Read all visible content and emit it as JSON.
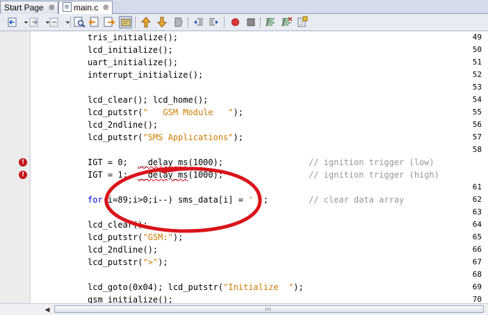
{
  "tabs": [
    {
      "label": "Start Page",
      "active": false
    },
    {
      "label": "main.c",
      "active": true
    }
  ],
  "tab_close_glyph": "⊗",
  "toolbar": {
    "buttons": [
      "back-icon",
      "back-dropdown-icon",
      "forward-icon",
      "forward-dropdown-icon",
      "find-icon",
      "find-previous-icon",
      "find-next-icon",
      "toggle-highlight-icon",
      "previous-bookmark-icon",
      "next-bookmark-icon",
      "toggle-bookmark-icon",
      "shift-left-icon",
      "shift-right-icon",
      "record-macro-icon",
      "stop-macro-icon",
      "comment-icon",
      "uncomment-icon"
    ]
  },
  "lines": [
    {
      "num": "49",
      "code": "tris_initialize();"
    },
    {
      "num": "50",
      "code": "lcd_initialize();"
    },
    {
      "num": "51",
      "code": "uart_initialize();"
    },
    {
      "num": "52",
      "code": "interrupt_initialize();"
    },
    {
      "num": "53",
      "code": ""
    },
    {
      "num": "54",
      "code": "lcd_clear(); lcd_home();"
    },
    {
      "num": "55",
      "pre": "lcd_putstr(",
      "str": "\"   GSM Module   \"",
      "post": ");"
    },
    {
      "num": "56",
      "code": "lcd_2ndline();"
    },
    {
      "num": "57",
      "pre": "lcd_putstr(",
      "str": "\"SMS Applications\"",
      "post": ");"
    },
    {
      "num": "58",
      "code": ""
    },
    {
      "num": "",
      "error": true,
      "pre": "IGT = 0;  ",
      "squig": "__delay_ms",
      "post": "(1000);",
      "comment": "// ignition trigger (low)"
    },
    {
      "num": "",
      "error": true,
      "pre": "IGT = 1;  ",
      "squig": "__delay_ms",
      "post": "(1000);",
      "comment": "// ignition trigger (high)"
    },
    {
      "num": "61",
      "code": ""
    },
    {
      "num": "62",
      "kw": "for",
      "post": "(i=89;i>0;i--) sms_data[i] = ",
      "str": "' '",
      "post2": ";",
      "comment": "// clear data array"
    },
    {
      "num": "63",
      "code": ""
    },
    {
      "num": "64",
      "code": "lcd_clear();"
    },
    {
      "num": "65",
      "pre": "lcd_putstr(",
      "str": "\"GSM:\"",
      "post": ");"
    },
    {
      "num": "66",
      "code": "lcd_2ndline();"
    },
    {
      "num": "67",
      "pre": "lcd_putstr(",
      "str": "\">\"",
      "post": ");"
    },
    {
      "num": "68",
      "code": ""
    },
    {
      "num": "69",
      "pre": "lcd_goto(0x04); lcd_putstr(",
      "str": "\"Initialize  \"",
      "post": ");"
    },
    {
      "num": "70",
      "code": "gsm_initialize();"
    }
  ],
  "error_glyph": "!",
  "scrollbar": {
    "left_arrow": "◀",
    "right_arrow": "▶"
  },
  "colors": {
    "keyword": "#0000e6",
    "string": "#ce7b00",
    "comment": "#969696",
    "annotation": "#d9141b"
  }
}
